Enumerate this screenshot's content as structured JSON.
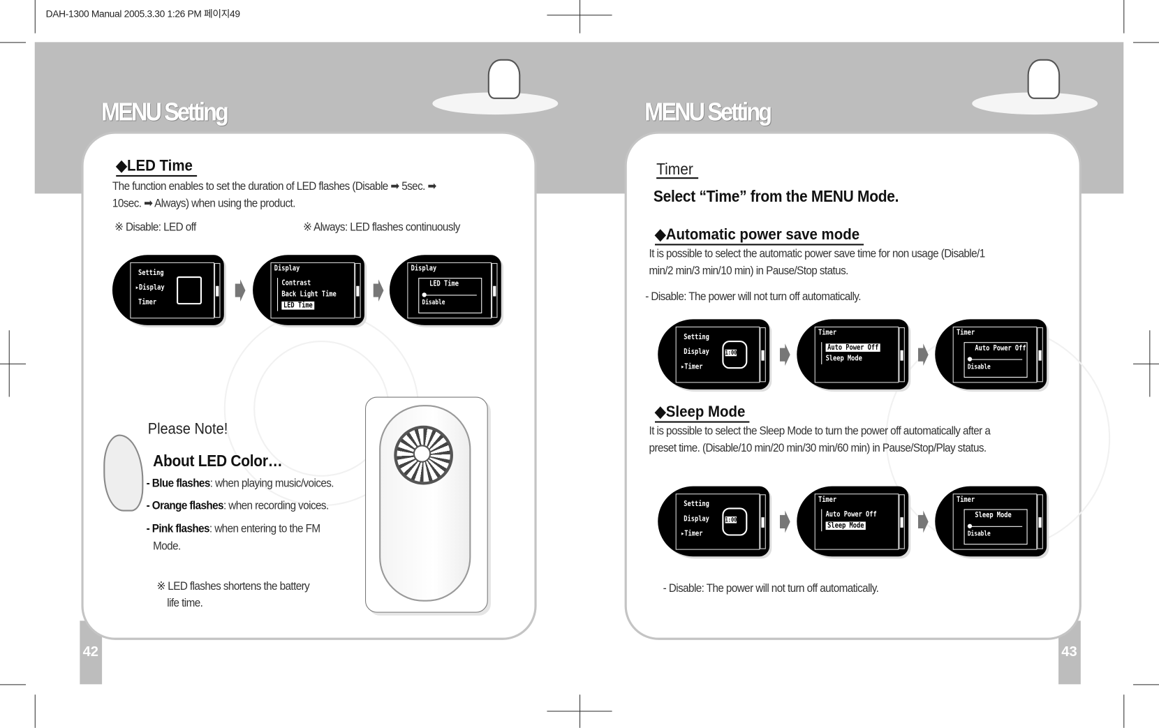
{
  "print_header": "DAH-1300 Manual  2005.3.30 1:26 PM  페이지49",
  "left_page": {
    "title": "MENU Setting",
    "page_number": "42",
    "section_heading": "◆LED Time",
    "description_line1": "The function enables to set the duration of LED flashes (Disable ➡ 5sec. ➡",
    "description_line2": "10sec. ➡ Always) when using the product.",
    "note_disable": "※ Disable: LED off",
    "note_always": "※ Always: LED flashes continuously",
    "please_note": "Please Note!",
    "about_heading": "About LED Color…",
    "colors": [
      {
        "label": "- Blue flashes",
        "text": ": when playing music/voices."
      },
      {
        "label": "- Orange flashes",
        "text": ": when recording voices."
      },
      {
        "label": "- Pink flashes",
        "text": ": when entering to the FM"
      }
    ],
    "colors_continuation": "Mode.",
    "battery_note_line1": "※ LED flashes shortens the battery",
    "battery_note_line2": "life time.",
    "screens": [
      {
        "type": "menu",
        "items": [
          "Setting",
          "Display",
          "Timer"
        ],
        "selected": 1,
        "icon": "monitor-icon"
      },
      {
        "type": "submenu",
        "title": "Display",
        "items": [
          "Contrast",
          "Back Light Time",
          "LED Time"
        ],
        "selected": 2
      },
      {
        "type": "slider",
        "title": "Display",
        "box_label": "LED Time",
        "value": "Disable"
      }
    ]
  },
  "right_page": {
    "title": "MENU Setting",
    "page_number": "43",
    "section_title": "Timer",
    "instruction": "Select “Time” from the MENU Mode.",
    "auto_power": {
      "heading": "◆Automatic power save mode",
      "line1": "It is possible to select the automatic power save time for non usage (Disable/1",
      "line2": "min/2 min/3 min/10 min) in Pause/Stop status.",
      "note": "- Disable: The power will not turn off automatically.",
      "screens": [
        {
          "type": "menu",
          "items": [
            "Setting",
            "Display",
            "Timer"
          ],
          "selected": 2,
          "icon": "watch-icon",
          "icon_text": "1:00"
        },
        {
          "type": "submenu",
          "title": "Timer",
          "items": [
            "Auto Power Off",
            "Sleep  Mode"
          ],
          "selected": 0
        },
        {
          "type": "slider",
          "title": "Timer",
          "box_label": "Auto Power Off",
          "value": "Disable"
        }
      ]
    },
    "sleep_mode": {
      "heading": "◆Sleep Mode",
      "line1": "It is possible to select the Sleep Mode to turn the power off automatically after a",
      "line2": "preset time. (Disable/10 min/20 min/30 min/60 min) in Pause/Stop/Play status.",
      "note": "- Disable: The power will not turn off automatically.",
      "screens": [
        {
          "type": "menu",
          "items": [
            "Setting",
            "Display",
            "Timer"
          ],
          "selected": 2,
          "icon": "watch-icon",
          "icon_text": "1:00"
        },
        {
          "type": "submenu",
          "title": "Timer",
          "items": [
            "Auto Power Off",
            "Sleep  Mode"
          ],
          "selected": 1
        },
        {
          "type": "slider",
          "title": "Timer",
          "box_label": "Sleep  Mode",
          "value": "Disable"
        }
      ]
    }
  }
}
